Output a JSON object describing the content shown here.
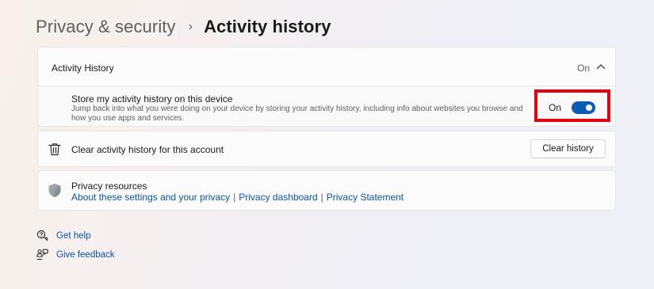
{
  "breadcrumb": {
    "parent": "Privacy & security",
    "separator": "›",
    "current": "Activity history"
  },
  "activity_section": {
    "title": "Activity History",
    "state": "On",
    "chevron": "chevron-up-icon"
  },
  "store_setting": {
    "title": "Store my activity history on this device",
    "description": "Jump back into what you were doing on your device by storing your activity history, including info about websites you browse and how you use apps and services.",
    "toggle_label": "On",
    "toggle_on": true
  },
  "clear_section": {
    "icon": "trash-icon",
    "label": "Clear activity history for this account",
    "button_label": "Clear history"
  },
  "privacy_resources": {
    "icon": "shield-icon",
    "title": "Privacy resources",
    "links": [
      "About these settings and your privacy",
      "Privacy dashboard",
      "Privacy Statement"
    ],
    "separator": "|"
  },
  "footer": {
    "get_help": "Get help",
    "give_feedback": "Give feedback"
  },
  "colors": {
    "accent": "#0b5cb5",
    "link": "#0a54a8",
    "highlight": "#e5000f"
  }
}
